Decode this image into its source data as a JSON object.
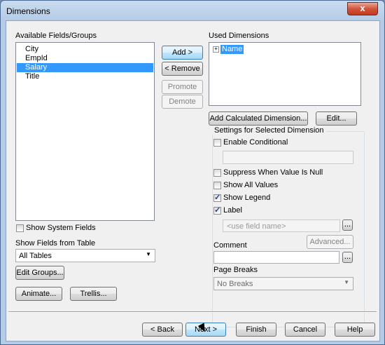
{
  "window": {
    "title": "Dimensions",
    "close_label": "x"
  },
  "available": {
    "label": "Available Fields/Groups",
    "items": [
      "City",
      "EmpId",
      "Salary",
      "Title"
    ],
    "selected": "Salary"
  },
  "middle_buttons": {
    "add": "Add >",
    "remove": "< Remove",
    "promote": "Promote",
    "demote": "Demote"
  },
  "used": {
    "label": "Used Dimensions",
    "items": [
      "Name"
    ],
    "expand_glyph": "+"
  },
  "used_buttons": {
    "add_calculated": "Add Calculated Dimension...",
    "edit": "Edit..."
  },
  "settings": {
    "title": "Settings for Selected Dimension",
    "enable_conditional": {
      "label": "Enable Conditional",
      "checked": false
    },
    "suppress_null": {
      "label": "Suppress When Value Is Null",
      "checked": false
    },
    "show_all_values": {
      "label": "Show All Values",
      "checked": false
    },
    "show_legend": {
      "label": "Show Legend",
      "checked": true
    },
    "label_opt": {
      "label": "Label",
      "checked": true
    },
    "label_placeholder": "<use field name>",
    "ellipsis": "...",
    "advanced": "Advanced...",
    "comment_label": "Comment",
    "page_breaks_label": "Page Breaks",
    "page_breaks_value": "No Breaks"
  },
  "left_options": {
    "show_system_fields": {
      "label": "Show System Fields",
      "checked": false
    },
    "show_fields_from_table_label": "Show Fields from Table",
    "table_value": "All Tables",
    "edit_groups": "Edit Groups...",
    "animate": "Animate...",
    "trellis": "Trellis..."
  },
  "footer": {
    "back": "< Back",
    "next": "Next >",
    "finish": "Finish",
    "cancel": "Cancel",
    "help": "Help"
  }
}
